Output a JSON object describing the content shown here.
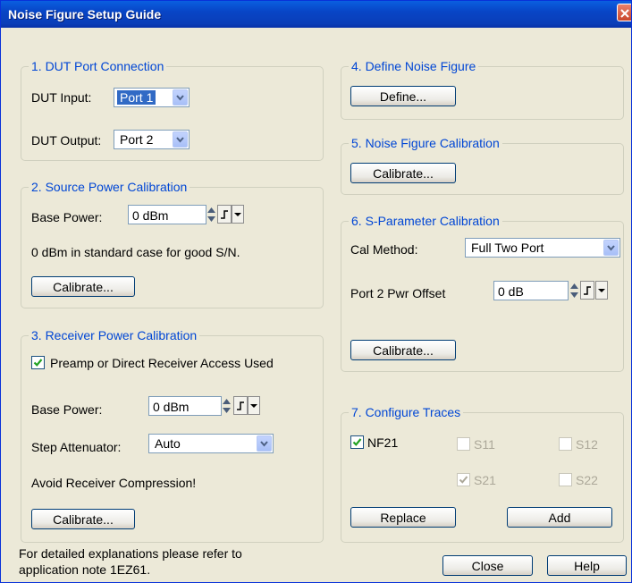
{
  "window": {
    "title": "Noise Figure Setup Guide"
  },
  "group1": {
    "title": "1. DUT Port Connection",
    "dut_input_label": "DUT Input:",
    "dut_input_value": "Port 1",
    "dut_output_label": "DUT Output:",
    "dut_output_value": "Port 2"
  },
  "group2": {
    "title": "2. Source Power Calibration",
    "base_power_label": "Base Power:",
    "base_power_value": "0 dBm",
    "note": "0 dBm in standard case for good S/N.",
    "calibrate_label": "Calibrate..."
  },
  "group3": {
    "title": "3. Receiver Power Calibration",
    "preamp_label": "Preamp or Direct Receiver Access Used",
    "preamp_checked": true,
    "base_power_label": "Base Power:",
    "base_power_value": "0 dBm",
    "step_att_label": "Step Attenuator:",
    "step_att_value": "Auto",
    "note": "Avoid Receiver Compression!",
    "calibrate_label": "Calibrate..."
  },
  "footer": {
    "note_line1": "For detailed explanations please refer to",
    "note_line2": "application note 1EZ61.",
    "close_label": "Close",
    "help_label": "Help"
  },
  "group4": {
    "title": "4. Define Noise Figure",
    "define_label": "Define..."
  },
  "group5": {
    "title": "5. Noise Figure Calibration",
    "calibrate_label": "Calibrate..."
  },
  "group6": {
    "title": "6. S-Parameter Calibration",
    "cal_method_label": "Cal Method:",
    "cal_method_value": "Full Two Port",
    "pwr_offset_label": "Port 2 Pwr Offset",
    "pwr_offset_value": "0 dB",
    "calibrate_label": "Calibrate..."
  },
  "group7": {
    "title": "7. Configure Traces",
    "traces": {
      "nf21": {
        "label": "NF21",
        "checked": true,
        "enabled": true
      },
      "s11": {
        "label": "S11",
        "checked": false,
        "enabled": false
      },
      "s12": {
        "label": "S12",
        "checked": false,
        "enabled": false
      },
      "s21": {
        "label": "S21",
        "checked": true,
        "enabled": false
      },
      "s22": {
        "label": "S22",
        "checked": false,
        "enabled": false
      }
    },
    "replace_label": "Replace",
    "add_label": "Add"
  },
  "icons": {
    "close": "close-icon",
    "dropdown": "chevron-down-icon",
    "spin": "spin-updown-icon",
    "step": "step-icon",
    "check": "checkmark-icon"
  },
  "colors": {
    "title_bar": "#0845c6",
    "group_title": "#0046d5",
    "selection": "#316ac5",
    "window_bg": "#ece9d8"
  }
}
